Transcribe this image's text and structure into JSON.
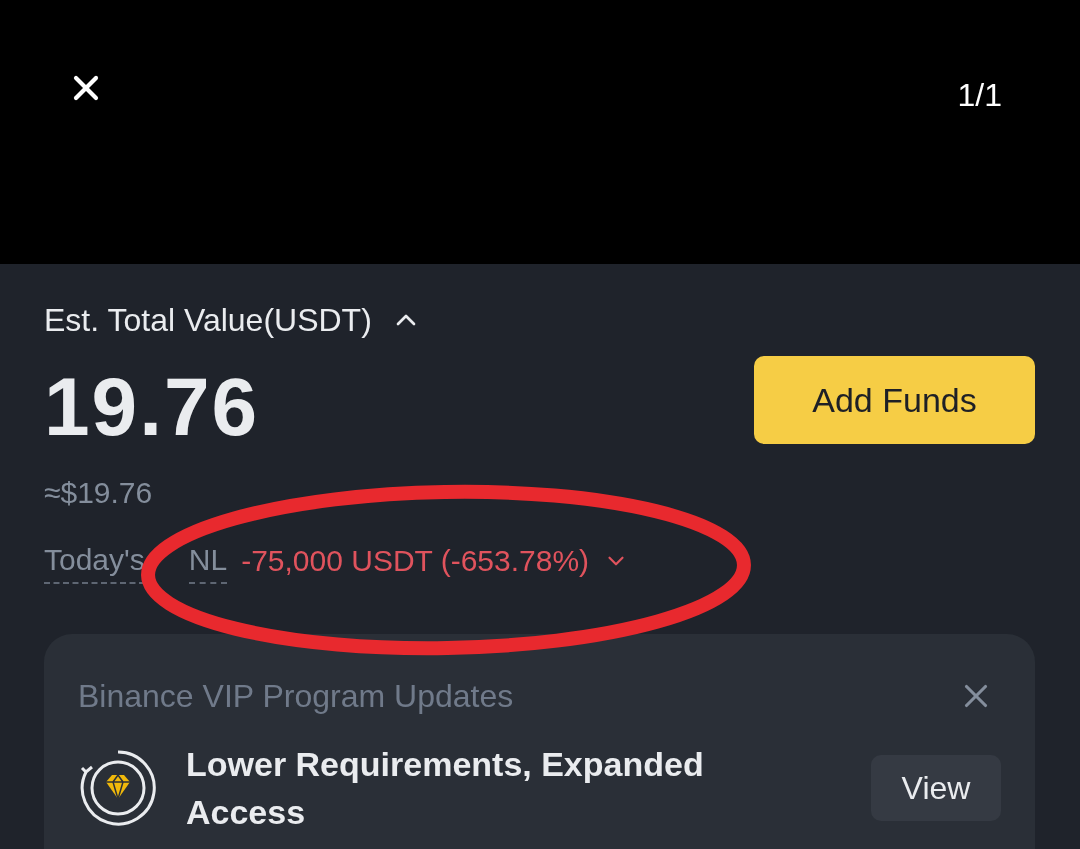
{
  "viewer": {
    "counter": "1/1"
  },
  "balance": {
    "label": "Est. Total Value(USDT)",
    "expanded": true,
    "amount": "19.76",
    "fiat": "≈$19.76",
    "pnl_label_parts": [
      "Today's",
      "NL"
    ],
    "pnl_value": "-75,000 USDT (-653.78%)",
    "add_funds": "Add Funds"
  },
  "promo": {
    "title": "Binance VIP Program Updates",
    "headline": "Lower Requirements, Expanded Access",
    "action": "View"
  }
}
